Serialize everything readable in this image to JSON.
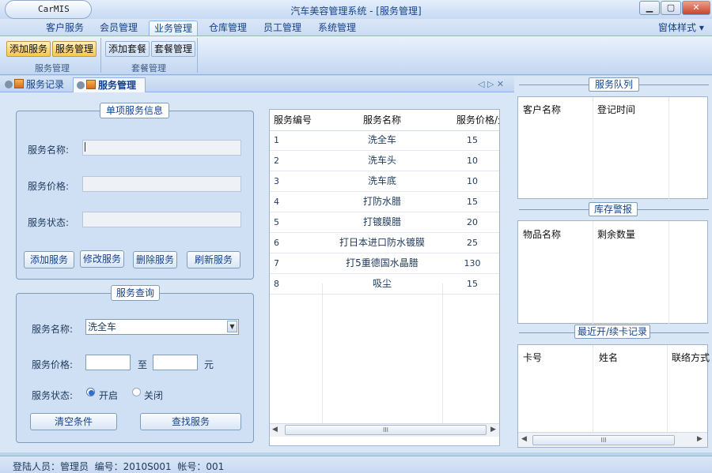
{
  "window": {
    "app_button": "CarMIS",
    "title": "汽车美容管理系统 - [服务管理]",
    "min_label": "▁",
    "max_label": "▢",
    "close_label": "✕"
  },
  "menu": {
    "tabs": [
      "客户服务",
      "会员管理",
      "业务管理",
      "仓库管理",
      "员工管理",
      "系统管理"
    ],
    "active": "业务管理",
    "right_label": "窗体样式",
    "right_arrow": "▾"
  },
  "ribbon": {
    "buttons": [
      "添加服务",
      "服务管理",
      "添加套餐",
      "套餐管理"
    ],
    "group_service": "服务管理",
    "group_package": "套餐管理"
  },
  "doc_tabs": {
    "items": [
      "服务记录",
      "服务管理"
    ],
    "nav": "◁ ▷ ✕"
  },
  "single_info": {
    "title": "单项服务信息",
    "name_label": "服务名称:",
    "price_label": "服务价格:",
    "status_label": "服务状态:",
    "name_value": "",
    "price_value": "",
    "status_value": "",
    "buttons": [
      "添加服务",
      "修改服务",
      "删除服务",
      "刷新服务"
    ]
  },
  "query": {
    "title": "服务查询",
    "name_label": "服务名称:",
    "name_value": "洗全车",
    "price_label": "服务价格:",
    "to_label": "至",
    "unit_label": "元",
    "price_from": "",
    "price_to": "",
    "status_label": "服务状态:",
    "opt_on": "开启",
    "opt_off": "关闭",
    "clear_button": "清空条件",
    "search_button": "查找服务"
  },
  "service_table": {
    "headers": [
      "服务编号",
      "服务名称",
      "服务价格/元"
    ],
    "rows": [
      [
        "1",
        "洗全车",
        "15"
      ],
      [
        "2",
        "洗车头",
        "10"
      ],
      [
        "3",
        "洗车底",
        "10"
      ],
      [
        "4",
        "打防水腊",
        "15"
      ],
      [
        "5",
        "打镀膜腊",
        "20"
      ],
      [
        "6",
        "打日本进口防水镀膜",
        "25"
      ],
      [
        "7",
        "打5重德国水晶腊",
        "130"
      ],
      [
        "8",
        "吸尘",
        "15"
      ]
    ],
    "scroll_thumb": "III"
  },
  "service_queue": {
    "title": "服务队列",
    "headers": [
      "客户名称",
      "登记时间"
    ]
  },
  "stock_alert": {
    "title": "库存警报",
    "headers": [
      "物品名称",
      "剩余数量"
    ]
  },
  "card_records": {
    "title": "最近开/续卡记录",
    "headers": [
      "卡号",
      "姓名",
      "联络方式"
    ],
    "scroll_thumb": "III"
  },
  "status": {
    "text": "登陆人员：管理员  编号：2010S001  帐号：001"
  }
}
